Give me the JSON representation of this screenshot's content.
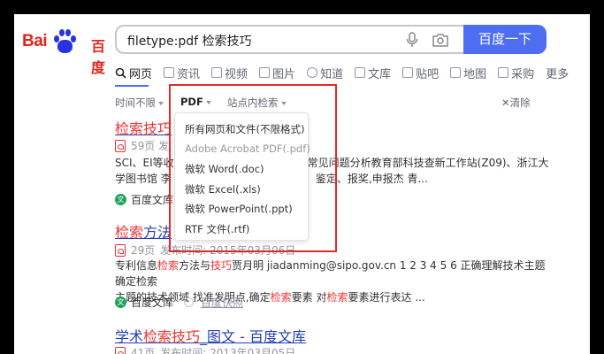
{
  "header": {
    "logo_bai": "Bai",
    "logo_du": "百度",
    "search_query": "filetype:pdf 检索技巧",
    "search_button": "百度一下"
  },
  "tabs": [
    {
      "label": "网页",
      "icon": "search-icon"
    },
    {
      "label": "资讯",
      "icon": "news-icon"
    },
    {
      "label": "视频",
      "icon": "video-icon"
    },
    {
      "label": "图片",
      "icon": "image-icon"
    },
    {
      "label": "知道",
      "icon": "question-icon"
    },
    {
      "label": "文库",
      "icon": "document-icon"
    },
    {
      "label": "贴吧",
      "icon": "tieba-icon"
    },
    {
      "label": "地图",
      "icon": "map-icon"
    },
    {
      "label": "采购",
      "icon": "cart-icon"
    },
    {
      "label": "更多",
      "icon": ""
    }
  ],
  "filters": {
    "time": "时间不限",
    "filetype": "PDF",
    "site": "站点内检索",
    "clear": "清除"
  },
  "dropdown": {
    "items": [
      "所有网页和文件(不限格式)",
      "Adobe Acrobat PDF(.pdf)",
      "微软 Word(.doc)",
      "微软 Excel(.xls)",
      "微软 PowerPoint(.ppt)",
      "RTF 文件(.rtf)"
    ]
  },
  "results": {
    "r1": {
      "title_a": "检索技巧",
      "meta": "59页 发",
      "snippet_l1a": "SCI、EI等收",
      "snippet_l1b": "及常见问题分析教育部科技查新工作站(Z09)、浙江大",
      "snippet_l2a": "学图书馆 李",
      "snippet_l2b": "项、鉴定、报奖,申报杰 青...",
      "source": "百度文库"
    },
    "r2": {
      "title_a": "检索",
      "title_b": "方法",
      "meta_pages": "29页",
      "meta_date": "发布时间: 2015年03月06日",
      "snippet_l1a": "专利信息",
      "snippet_l1b": "检索",
      "snippet_l1c": "方法与",
      "snippet_l1d": "技巧",
      "snippet_l1e": "贾月明 jiadanming@sipo.gov.cn 1 2 3 4 5 6 正确理解技术主题 确定检索",
      "snippet_l2a": "主题的技术领域 找准发明点,确定",
      "snippet_l2b": "检索",
      "snippet_l2c": "要素 对",
      "snippet_l2d": "检索",
      "snippet_l2e": "要素进行表达 ...",
      "source": "百度文库",
      "cache": "百度快照"
    },
    "r3": {
      "title_a": "学术",
      "title_b": "检索技巧",
      "title_c": "_图文 - 百度文库",
      "meta_pages": "41页",
      "meta_date": "发布时间: 2013年03月05日"
    }
  }
}
